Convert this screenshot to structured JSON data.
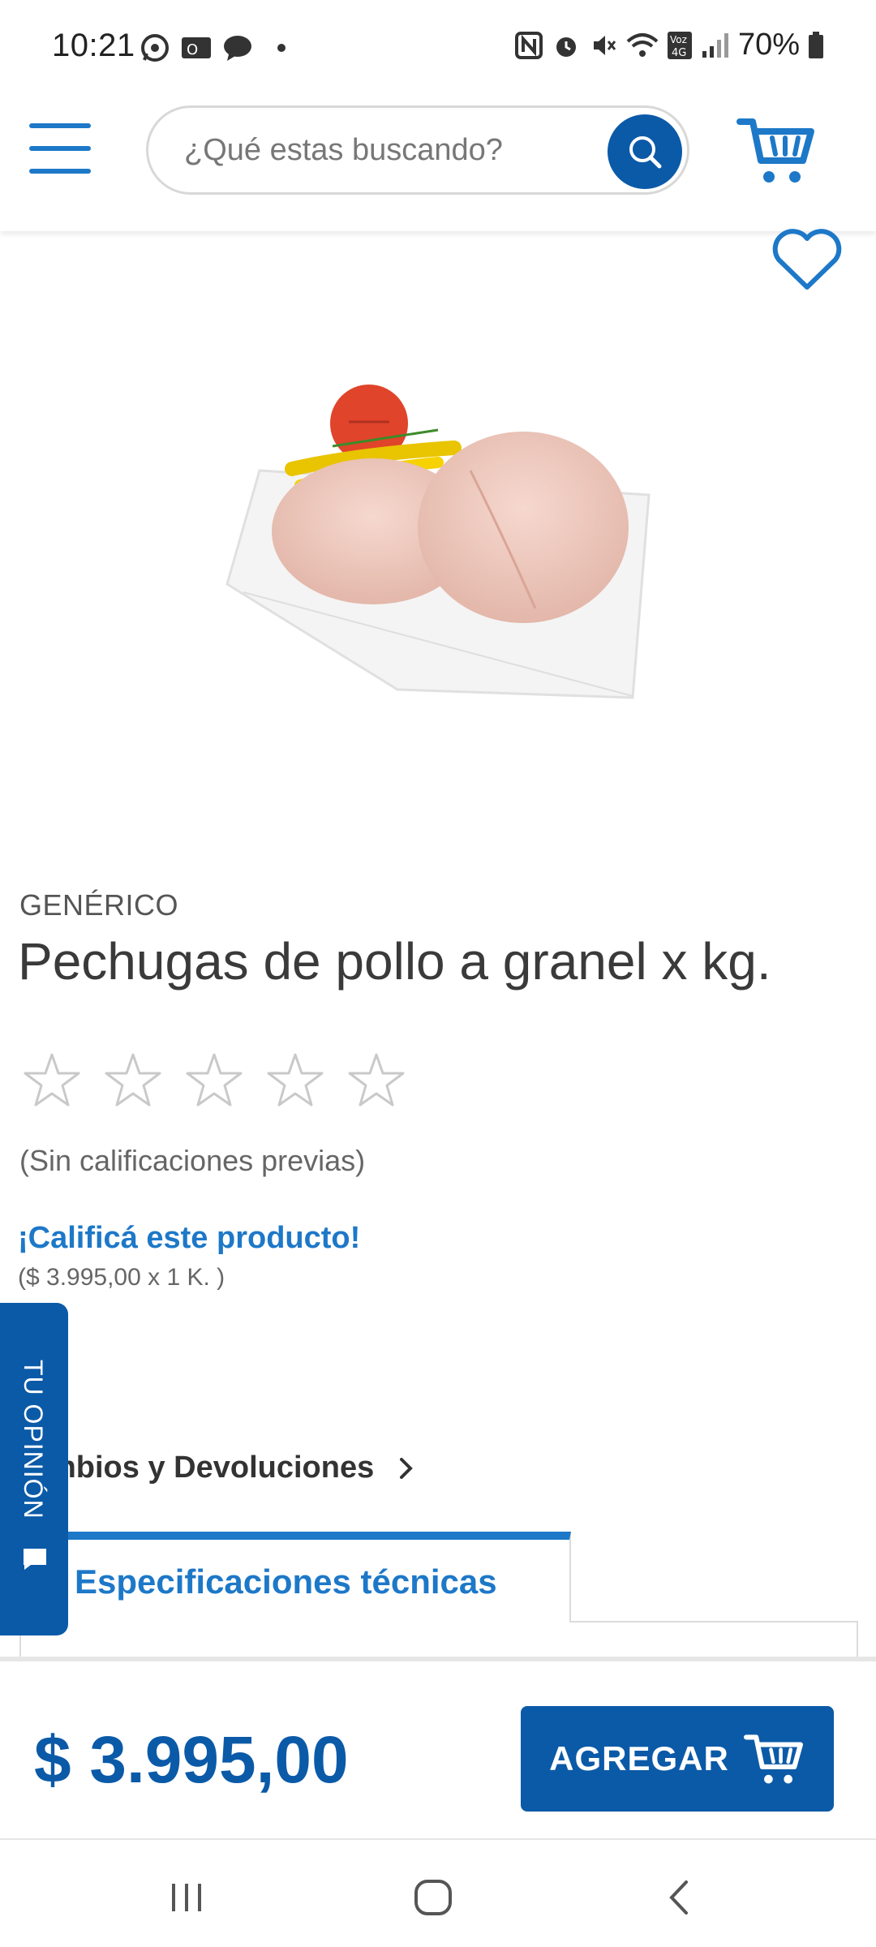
{
  "status_bar": {
    "time": "10:21",
    "battery": "70%",
    "icons": [
      "whatsapp-icon",
      "outlook-icon",
      "chat-icon",
      "nfc-icon",
      "alarm-icon",
      "mute-icon",
      "wifi-icon",
      "volte-icon",
      "signal-icon",
      "battery-icon"
    ]
  },
  "header": {
    "search_placeholder": "¿Qué estas buscando?"
  },
  "product": {
    "brand": "GENÉRICO",
    "title": "Pechugas de pollo a granel x kg.",
    "rating_stars": 0,
    "rating_max": 5,
    "no_rating_text": "(Sin calificaciones previas)",
    "rate_link": "¡Calificá este producto!",
    "unit_price": "($ 3.995,00 x 1 K. )"
  },
  "returns_link": "mbios y Devoluciones",
  "tabs": {
    "active": "Especificaciones técnicas"
  },
  "feedback_tab": "TU OPINIÓN",
  "purchase": {
    "price": "$ 3.995,00",
    "add_label": "AGREGAR"
  },
  "colors": {
    "primary": "#0b5aa8",
    "accent": "#1d78c8"
  }
}
